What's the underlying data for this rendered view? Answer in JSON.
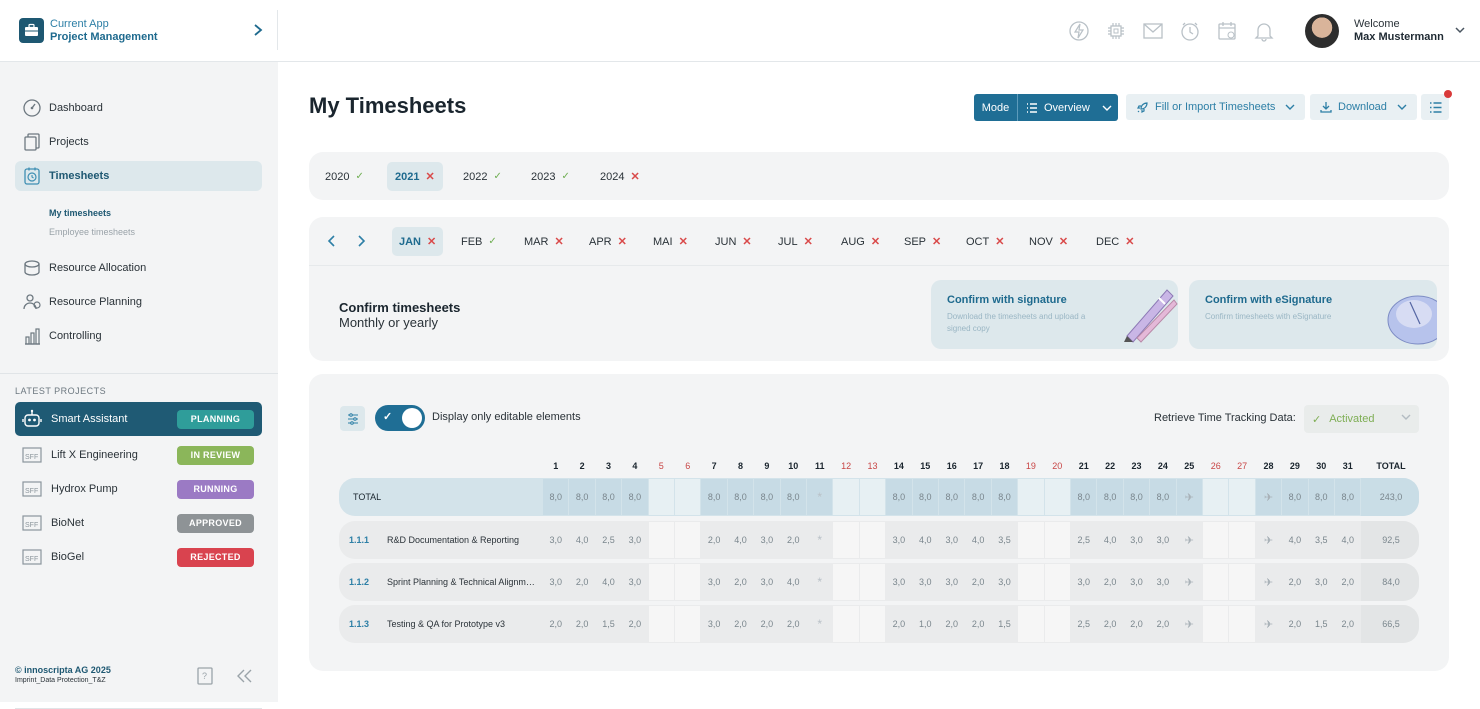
{
  "header": {
    "app_small": "Current App",
    "app_big": "Project Management",
    "welcome": "Welcome",
    "user_name": "Max Mustermann",
    "icons": [
      "lightning-icon",
      "chip-icon",
      "mail-icon",
      "clock-icon",
      "calendar-icon",
      "bell-icon"
    ]
  },
  "sidebar": {
    "items": [
      {
        "label": "Dashboard",
        "icon": "speedometer-icon"
      },
      {
        "label": "Projects",
        "icon": "documents-icon"
      },
      {
        "label": "Timesheets",
        "icon": "timesheet-icon"
      },
      {
        "label": "Resource Allocation",
        "icon": "coins-icon"
      },
      {
        "label": "Resource Planning",
        "icon": "people-icon"
      },
      {
        "label": "Controlling",
        "icon": "bar-chart-icon"
      }
    ],
    "subitems": [
      "My timesheets",
      "Employee timesheets"
    ],
    "latest_title": "LATEST PROJECTS",
    "projects": [
      {
        "label": "Smart Assistant",
        "status": "PLANNING",
        "color": "#2f9d9a"
      },
      {
        "label": "Lift X Engineering",
        "status": "IN REVIEW",
        "color": "#8bb65a"
      },
      {
        "label": "Hydrox Pump",
        "status": "RUNNING",
        "color": "#9b7ac4"
      },
      {
        "label": "BioNet",
        "status": "APPROVED",
        "color": "#8e9396"
      },
      {
        "label": "BioGel",
        "status": "REJECTED",
        "color": "#d9434f"
      }
    ],
    "copyright": "© innoscripta AG 2025",
    "imprint": "Imprint_Data Protection_T&Z"
  },
  "page": {
    "title": "My Timesheets",
    "mode_label": "Mode",
    "overview_label": "Overview",
    "fill_label": "Fill or Import Timesheets",
    "download_label": "Download"
  },
  "years": [
    {
      "label": "2020",
      "state": "ok"
    },
    {
      "label": "2021",
      "state": "no",
      "active": true
    },
    {
      "label": "2022",
      "state": "ok"
    },
    {
      "label": "2023",
      "state": "ok"
    },
    {
      "label": "2024",
      "state": "no"
    }
  ],
  "months": [
    {
      "label": "JAN",
      "state": "no",
      "active": true
    },
    {
      "label": "FEB",
      "state": "ok"
    },
    {
      "label": "MAR",
      "state": "no"
    },
    {
      "label": "APR",
      "state": "no"
    },
    {
      "label": "MAI",
      "state": "no"
    },
    {
      "label": "JUN",
      "state": "no"
    },
    {
      "label": "JUL",
      "state": "no"
    },
    {
      "label": "AUG",
      "state": "no"
    },
    {
      "label": "SEP",
      "state": "no"
    },
    {
      "label": "OCT",
      "state": "no"
    },
    {
      "label": "NOV",
      "state": "no"
    },
    {
      "label": "DEC",
      "state": "no"
    }
  ],
  "confirm": {
    "title": "Confirm timesheets",
    "subtitle": "Monthly or yearly",
    "sig_title": "Confirm with signature",
    "sig_desc": "Download the timesheets and upload a signed copy",
    "esig_title": "Confirm with eSignature",
    "esig_desc": "Confirm timesheets with eSignature"
  },
  "table_controls": {
    "toggle_label": "Display only editable elements",
    "retrieve_label": "Retrieve Time Tracking Data:",
    "retrieve_value": "Activated"
  },
  "table": {
    "days": [
      "1",
      "2",
      "3",
      "4",
      "5",
      "6",
      "7",
      "8",
      "9",
      "10",
      "11",
      "12",
      "13",
      "14",
      "15",
      "16",
      "17",
      "18",
      "19",
      "20",
      "21",
      "22",
      "23",
      "24",
      "25",
      "26",
      "27",
      "28",
      "29",
      "30",
      "31"
    ],
    "weekend_days": [
      "5",
      "6",
      "12",
      "13",
      "19",
      "20",
      "26",
      "27"
    ],
    "total_header": "TOTAL",
    "total_row": {
      "label": "TOTAL",
      "values": [
        "8,0",
        "8,0",
        "8,0",
        "8,0",
        "",
        "",
        "8,0",
        "8,0",
        "8,0",
        "8,0",
        "*",
        "",
        "",
        "8,0",
        "8,0",
        "8,0",
        "8,0",
        "8,0",
        "",
        "",
        "8,0",
        "8,0",
        "8,0",
        "8,0",
        "✈",
        "",
        "",
        "✈",
        "8,0",
        "8,0",
        "8,0"
      ],
      "total": "243,0"
    },
    "rows": [
      {
        "id": "1.1.1",
        "name": "R&D Documentation & Reporting",
        "values": [
          "3,0",
          "4,0",
          "2,5",
          "3,0",
          "",
          "",
          "2,0",
          "4,0",
          "3,0",
          "2,0",
          "*",
          "",
          "",
          "3,0",
          "4,0",
          "3,0",
          "4,0",
          "3,5",
          "",
          "",
          "2,5",
          "4,0",
          "3,0",
          "3,0",
          "✈",
          "",
          "",
          "✈",
          "4,0",
          "3,5",
          "4,0"
        ],
        "total": "92,5"
      },
      {
        "id": "1.1.2",
        "name": "Sprint Planning & Technical Alignment",
        "values": [
          "3,0",
          "2,0",
          "4,0",
          "3,0",
          "",
          "",
          "3,0",
          "2,0",
          "3,0",
          "4,0",
          "*",
          "",
          "",
          "3,0",
          "3,0",
          "3,0",
          "2,0",
          "3,0",
          "",
          "",
          "3,0",
          "2,0",
          "3,0",
          "3,0",
          "✈",
          "",
          "",
          "✈",
          "2,0",
          "3,0",
          "2,0"
        ],
        "total": "84,0"
      },
      {
        "id": "1.1.3",
        "name": "Testing & QA for Prototype v3",
        "values": [
          "2,0",
          "2,0",
          "1,5",
          "2,0",
          "",
          "",
          "3,0",
          "2,0",
          "2,0",
          "2,0",
          "*",
          "",
          "",
          "2,0",
          "1,0",
          "2,0",
          "2,0",
          "1,5",
          "",
          "",
          "2,5",
          "2,0",
          "2,0",
          "2,0",
          "✈",
          "",
          "",
          "✈",
          "2,0",
          "1,5",
          "2,0"
        ],
        "total": "66,5"
      }
    ]
  }
}
